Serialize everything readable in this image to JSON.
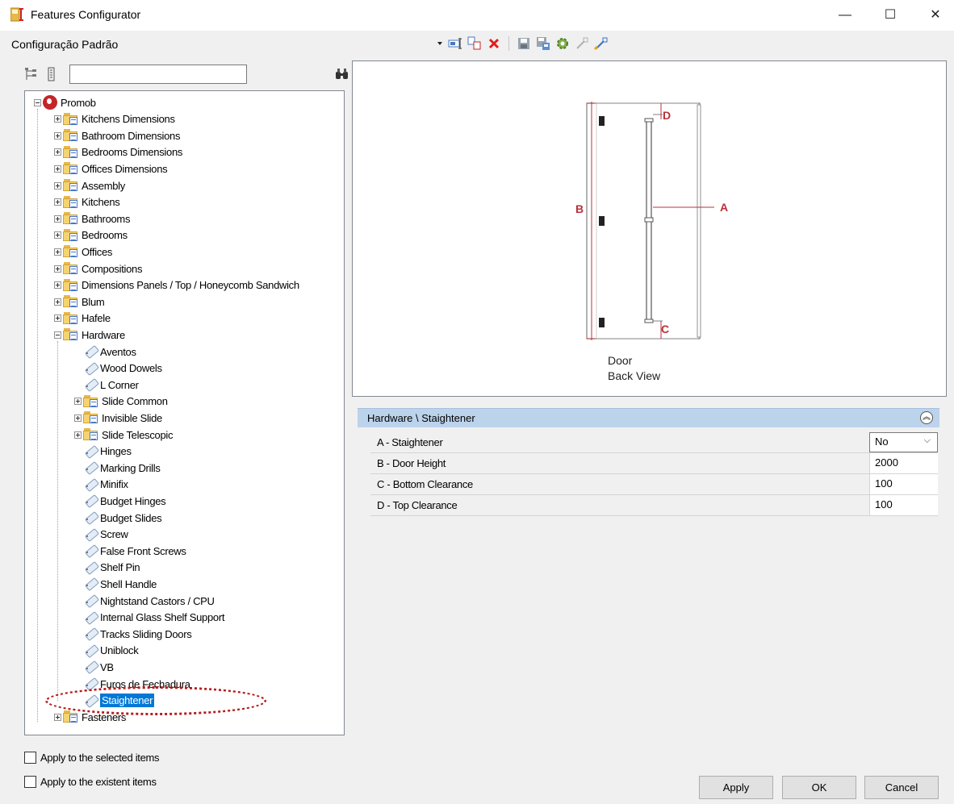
{
  "window": {
    "title": "Features Configurator",
    "minimize_glyph": "—",
    "maximize_glyph": "☐",
    "close_glyph": "✕"
  },
  "profile_label": "Configuração Padrão",
  "toolbar": {
    "icons": [
      "dropdown-arrow-icon",
      "rename-icon",
      "copy-icon",
      "delete-icon",
      "save-icon",
      "save-as-icon",
      "settings-icon",
      "export-icon",
      "import-icon"
    ]
  },
  "search": {
    "value": "",
    "placeholder": ""
  },
  "tree": {
    "root": "Promob",
    "top_folders": [
      "Kitchens Dimensions",
      "Bathroom Dimensions",
      "Bedrooms Dimensions",
      "Offices Dimensions",
      "Assembly",
      "Kitchens",
      "Bathrooms",
      "Bedrooms",
      "Offices",
      "Compositions",
      "Dimensions Panels / Top / Honeycomb Sandwich",
      "Blum",
      "Hafele"
    ],
    "hardware_label": "Hardware",
    "hardware_items": [
      {
        "label": "Aventos",
        "type": "item"
      },
      {
        "label": "Wood Dowels",
        "type": "item"
      },
      {
        "label": "L Corner",
        "type": "item"
      },
      {
        "label": "Slide Common",
        "type": "folder"
      },
      {
        "label": "Invisible Slide",
        "type": "folder"
      },
      {
        "label": "Slide Telescopic",
        "type": "folder"
      },
      {
        "label": "Hinges",
        "type": "item"
      },
      {
        "label": "Marking Drills",
        "type": "item"
      },
      {
        "label": "Minifix",
        "type": "item"
      },
      {
        "label": "Budget Hinges",
        "type": "item"
      },
      {
        "label": "Budget Slides",
        "type": "item"
      },
      {
        "label": "Screw",
        "type": "item"
      },
      {
        "label": "False Front Screws",
        "type": "item"
      },
      {
        "label": "Shelf Pin",
        "type": "item"
      },
      {
        "label": "Shell Handle",
        "type": "item"
      },
      {
        "label": "Nightstand Castors  / CPU",
        "type": "item"
      },
      {
        "label": "Internal Glass Shelf Support",
        "type": "item"
      },
      {
        "label": "Tracks Sliding Doors",
        "type": "item"
      },
      {
        "label": "Uniblock",
        "type": "item"
      },
      {
        "label": "VB",
        "type": "item"
      },
      {
        "label": "Furos de Fechadura",
        "type": "item"
      },
      {
        "label": "Staightener",
        "type": "item",
        "selected": true
      }
    ],
    "last_folder": "Fasteners"
  },
  "preview": {
    "label_a": "A",
    "label_b": "B",
    "label_c": "C",
    "label_d": "D",
    "caption_line1": "Door",
    "caption_line2": "Back View"
  },
  "properties": {
    "header": "Hardware \\ Staightener",
    "rows": [
      {
        "name": "A - Staightener",
        "value": "No",
        "kind": "select"
      },
      {
        "name": "B - Door Height",
        "value": "2000",
        "kind": "text"
      },
      {
        "name": "C - Bottom Clearance",
        "value": "100",
        "kind": "text"
      },
      {
        "name": "D - Top Clearance",
        "value": "100",
        "kind": "text"
      }
    ]
  },
  "checkboxes": {
    "selected_items": "Apply to the selected items",
    "existent_items": "Apply to the existent items"
  },
  "buttons": {
    "apply": "Apply",
    "ok": "OK",
    "cancel": "Cancel"
  },
  "colors": {
    "selection": "#0078d7",
    "annotation": "#b51a1a",
    "header_bg": "#bcd3ec",
    "dimension_red": "#b8323b"
  }
}
